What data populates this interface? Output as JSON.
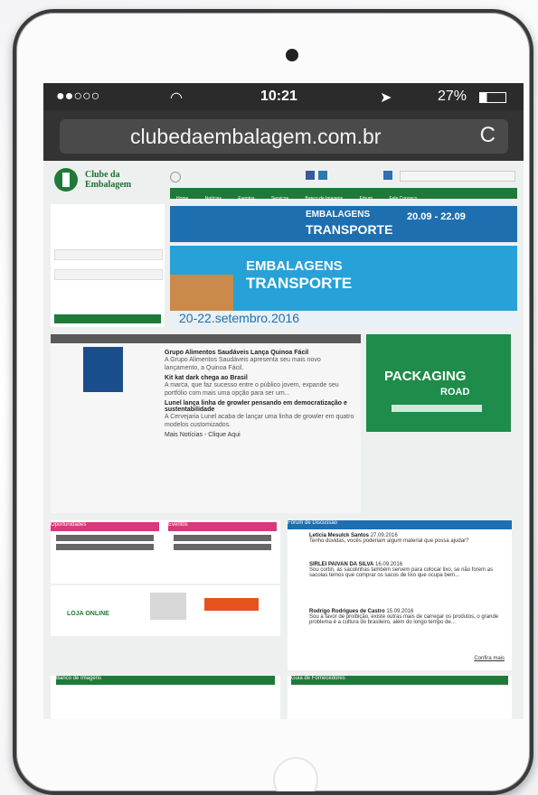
{
  "status_bar": {
    "signal": "●●○○○",
    "time": "10:21",
    "battery": "27%"
  },
  "browser": {
    "url": "clubedaembalagem.com.br",
    "reload_icon": "C"
  },
  "site": {
    "logo_line1": "Clube da",
    "logo_line2": "Embalagem",
    "banner1_title": "EMBALAGENS",
    "banner1_sub": "TRANSPORTE",
    "banner1_dates": "20.09 - 22.09",
    "banner2_title": "EMBALAGENS",
    "banner2_sub": "TRANSPORTE",
    "banner2_date": "20-22.setembro.2016",
    "news": [
      {
        "headline": "Grupo Alimentos Saudáveis Lança Quinoa Fácil",
        "desc": "A Grupo Alimentos Saudáveis apresenta seu mais novo lançamento, a Quinoa Fácil."
      },
      {
        "headline": "Kit kat dark chega ao Brasil",
        "desc": "A marca, que faz sucesso entre o público jovem, expande seu portfólio com mais uma opção para ser um..."
      },
      {
        "headline": "Lunel lança linha de growler pensando em democratização e sustentabilidade",
        "desc": "A Cervejaria Lunel acaba de lançar uma linha de growler em quatro modelos customizados."
      }
    ],
    "news_more": "Mais Notícias - Clique Aqui",
    "pack_title": "PACKAGING",
    "pack_road": "ROAD",
    "oport_tag": "Oportunidades",
    "eventos_tag": "Eventos",
    "loja": "LOJA ONLINE",
    "forum_title": "Fórum de Discussão",
    "forum": [
      {
        "name": "Leticia Mesulck Santos",
        "date": "27.09.2016",
        "text": "Tenho dúvidas, vocês poderiam algum material que possa ajudar?"
      },
      {
        "name": "SIRLEI PAIVAN DA SILVA",
        "date": "16.09.2016",
        "text": "Sou cortin, as sacolinhas também servem para colocar lixo, se não forem as sacolas temos que comprar os sacos de lixo que ocupa bem..."
      },
      {
        "name": "Rodrigo Rodrigues de Castro",
        "date": "15.09.2016",
        "text": "Sou a favor de proibição, existe outras mais de carregar os produtos, o grande problema é a cultura do brasileiro, além do longo tempo de..."
      }
    ],
    "forum_more": "Confira mais",
    "bank_title": "Banco de Imagens",
    "guia_title": "Guia de Fornecedores"
  }
}
